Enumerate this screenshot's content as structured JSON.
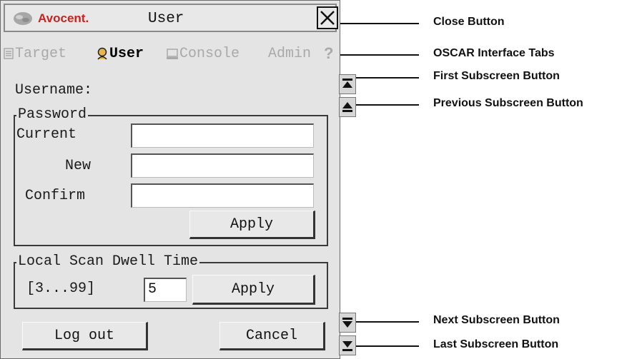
{
  "window": {
    "brand": "Avocent.",
    "title": "User"
  },
  "tabs": [
    {
      "label": "Target",
      "icon": "target-list-icon",
      "active": false
    },
    {
      "label": "User",
      "icon": "user-icon",
      "active": true
    },
    {
      "label": "Console",
      "icon": "console-icon",
      "active": false
    },
    {
      "label": "Admin",
      "icon": "",
      "active": false
    },
    {
      "label": "?",
      "icon": "help-icon",
      "active": false
    }
  ],
  "form": {
    "username_label": "Username:",
    "password_group": "Password",
    "current_label": "Current",
    "new_label": "New",
    "confirm_label": "Confirm",
    "current_value": "",
    "new_value": "",
    "confirm_value": "",
    "password_apply": "Apply",
    "dwell_group": "Local Scan Dwell Time",
    "dwell_range": "[3...99]",
    "dwell_value": "5",
    "dwell_apply": "Apply",
    "logout": "Log out",
    "cancel": "Cancel"
  },
  "callouts": {
    "close": "Close Button",
    "tabs": "OSCAR Interface Tabs",
    "first": "First Subscreen Button",
    "previous": "Previous Subscreen Button",
    "next": "Next Subscreen Button",
    "last": "Last Subscreen Button"
  },
  "colors": {
    "brand_red": "#c8231f",
    "window_bg": "#e4e4e4",
    "inactive_tab_text": "#a9a9a9"
  }
}
